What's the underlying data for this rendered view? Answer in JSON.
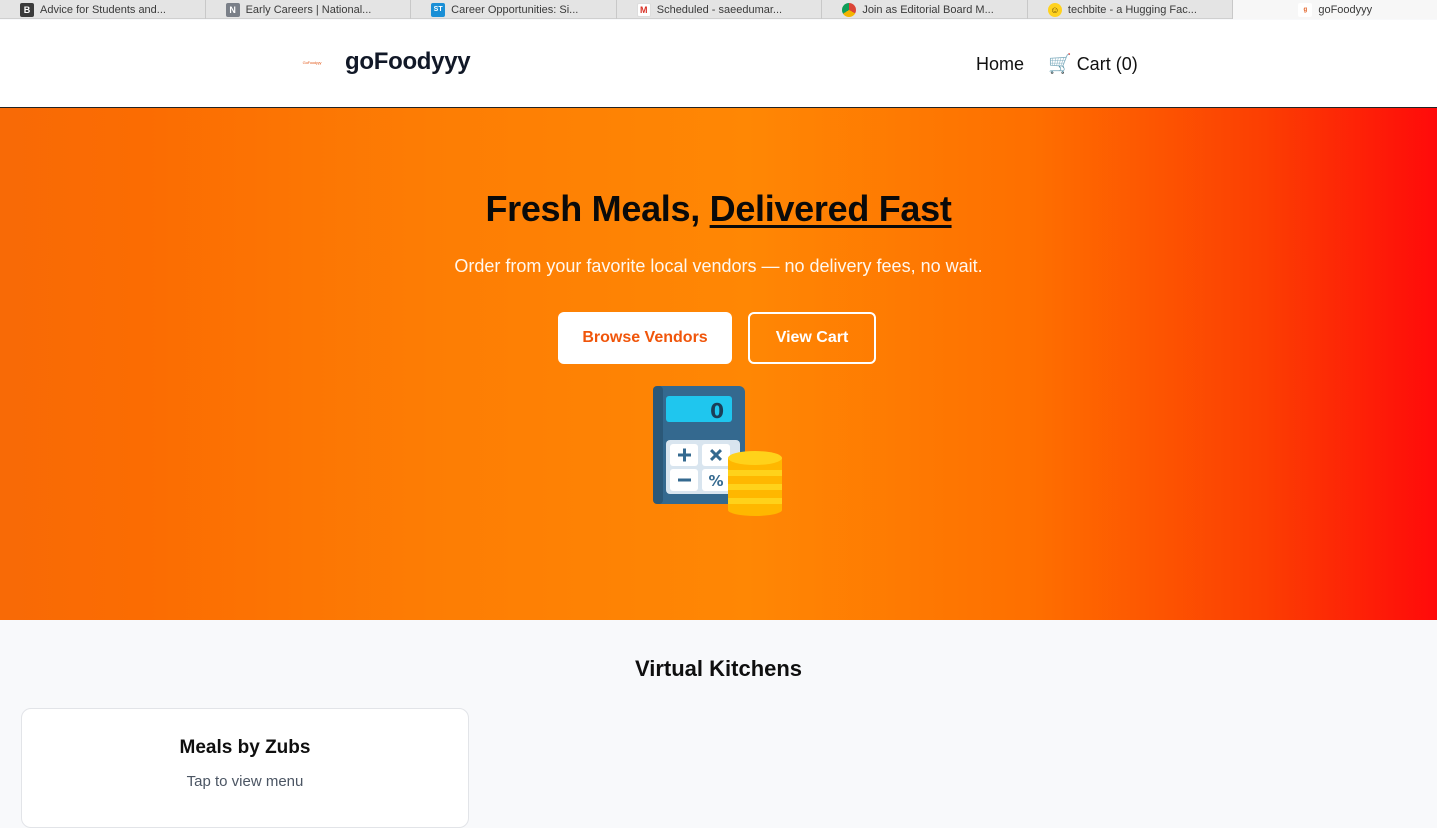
{
  "browser": {
    "tabs": [
      {
        "title": "Advice for Students and...",
        "icon": "blog-b-icon",
        "color": "#3b3b3b",
        "glyph": "B"
      },
      {
        "title": "Early Careers | National...",
        "icon": "n-icon",
        "color": "#7a7f88",
        "glyph": "N"
      },
      {
        "title": "Career Opportunities: Si...",
        "icon": "st-icon",
        "color": "#1a8fd6",
        "glyph": "ST"
      },
      {
        "title": "Scheduled - saeedumar...",
        "icon": "gmail-icon",
        "color": "#d93025",
        "glyph": "M"
      },
      {
        "title": "Join as Editorial Board M...",
        "icon": "chrome-icon",
        "color": "#f2a60c",
        "glyph": "●"
      },
      {
        "title": "techbite - a Hugging Fac...",
        "icon": "hugging-face-icon",
        "color": "#ffd21e",
        "glyph": "☺"
      },
      {
        "title": "goFoodyyy",
        "icon": "gofoodyyy-favicon",
        "color": "#e25a1c",
        "glyph": "g",
        "active": true
      }
    ]
  },
  "header": {
    "logo_text": "GoFoodyyy",
    "brand_name": "goFoodyyy",
    "nav": {
      "home": "Home",
      "cart": "Cart (0)",
      "cart_icon": "shopping-cart-icon"
    }
  },
  "hero": {
    "title_prefix": "Fresh Meals, ",
    "title_highlight": "Delivered Fast",
    "subtitle": "Order from your favorite local vendors — no delivery fees, no wait.",
    "primary_button": "Browse Vendors",
    "secondary_button": "View Cart",
    "illustration": "calculator-coins-icon",
    "calculator_display": "0",
    "colors": {
      "primary_text": "#f0550a",
      "gradient_start": "#f86a06",
      "gradient_end": "#ff0a0a"
    }
  },
  "kitchens": {
    "title": "Virtual Kitchens",
    "items": [
      {
        "name": "Meals by Zubs",
        "hint": "Tap to view menu"
      }
    ]
  }
}
